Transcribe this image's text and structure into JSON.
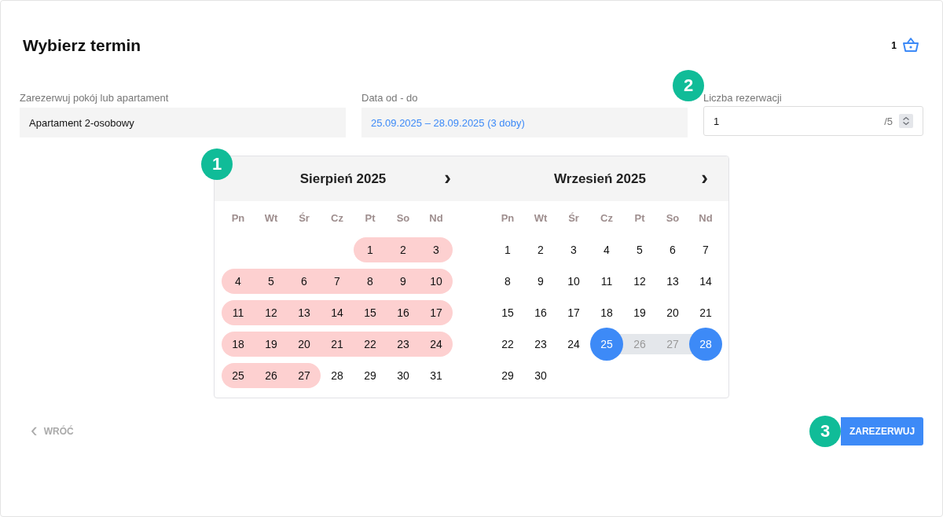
{
  "title": "Wybierz termin",
  "cart": {
    "count": "1"
  },
  "fields": [
    {
      "label": "Zarezerwuj pokój lub apartament",
      "value": "Apartament 2-osobowy",
      "kind": "select"
    },
    {
      "label": "Data od - do",
      "value": "25.09.2025 – 28.09.2025 (3 doby)",
      "kind": "date"
    },
    {
      "label": "Liczba rezerwacji",
      "value": "1",
      "max": "/5",
      "kind": "number",
      "step": "2"
    }
  ],
  "calendar": {
    "step": "1",
    "months": [
      {
        "title": "Sierpień 2025",
        "next": "›",
        "weekdays": [
          "Pn",
          "Wt",
          "Śr",
          "Cz",
          "Pt",
          "So",
          "Nd"
        ],
        "weeks": [
          {
            "kind": "right_aligned",
            "days": [
              {
                "day": "1",
                "kind": "blocked"
              },
              {
                "day": "2",
                "kind": "blocked"
              },
              {
                "day": "3",
                "kind": "blocked"
              }
            ]
          },
          {
            "days": [
              {
                "day": "4",
                "kind": "blocked"
              },
              {
                "day": "5",
                "kind": "blocked"
              },
              {
                "day": "6",
                "kind": "blocked"
              },
              {
                "day": "7",
                "kind": "blocked"
              },
              {
                "day": "8",
                "kind": "blocked"
              },
              {
                "day": "9",
                "kind": "blocked"
              },
              {
                "day": "10",
                "kind": "blocked"
              }
            ]
          },
          {
            "days": [
              {
                "day": "11",
                "kind": "blocked"
              },
              {
                "day": "12",
                "kind": "blocked"
              },
              {
                "day": "13",
                "kind": "blocked"
              },
              {
                "day": "14",
                "kind": "blocked"
              },
              {
                "day": "15",
                "kind": "blocked"
              },
              {
                "day": "16",
                "kind": "blocked"
              },
              {
                "day": "17",
                "kind": "blocked"
              }
            ]
          },
          {
            "days": [
              {
                "day": "18",
                "kind": "blocked"
              },
              {
                "day": "19",
                "kind": "blocked"
              },
              {
                "day": "20",
                "kind": "blocked"
              },
              {
                "day": "21",
                "kind": "blocked"
              },
              {
                "day": "22",
                "kind": "blocked"
              },
              {
                "day": "23",
                "kind": "blocked"
              },
              {
                "day": "24",
                "kind": "blocked"
              }
            ]
          },
          {
            "days": [
              {
                "day": "25",
                "kind": "blocked"
              },
              {
                "day": "26",
                "kind": "blocked"
              },
              {
                "day": "27",
                "kind": "blocked"
              },
              {
                "day": "28",
                "kind": "free"
              },
              {
                "day": "29",
                "kind": "free"
              },
              {
                "day": "30",
                "kind": "free"
              },
              {
                "day": "31",
                "kind": "free"
              }
            ]
          }
        ]
      },
      {
        "title": "Wrzesień 2025",
        "next": "›",
        "weekdays": [
          "Pn",
          "Wt",
          "Śr",
          "Cz",
          "Pt",
          "So",
          "Nd"
        ],
        "weeks": [
          {
            "days": [
              {
                "day": "1",
                "kind": "free"
              },
              {
                "day": "2",
                "kind": "free"
              },
              {
                "day": "3",
                "kind": "free"
              },
              {
                "day": "4",
                "kind": "free"
              },
              {
                "day": "5",
                "kind": "free"
              },
              {
                "day": "6",
                "kind": "free"
              },
              {
                "day": "7",
                "kind": "free"
              }
            ]
          },
          {
            "days": [
              {
                "day": "8",
                "kind": "free"
              },
              {
                "day": "9",
                "kind": "free"
              },
              {
                "day": "10",
                "kind": "free"
              },
              {
                "day": "11",
                "kind": "free"
              },
              {
                "day": "12",
                "kind": "free"
              },
              {
                "day": "13",
                "kind": "free"
              },
              {
                "day": "14",
                "kind": "free"
              }
            ]
          },
          {
            "days": [
              {
                "day": "15",
                "kind": "free"
              },
              {
                "day": "16",
                "kind": "free"
              },
              {
                "day": "17",
                "kind": "free"
              },
              {
                "day": "18",
                "kind": "free"
              },
              {
                "day": "19",
                "kind": "free"
              },
              {
                "day": "20",
                "kind": "free"
              },
              {
                "day": "21",
                "kind": "free"
              }
            ]
          },
          {
            "days": [
              {
                "day": "22",
                "kind": "free"
              },
              {
                "day": "23",
                "kind": "free"
              },
              {
                "day": "24",
                "kind": "free"
              },
              {
                "day": "25",
                "kind": "selected"
              },
              {
                "day": "26",
                "kind": "range"
              },
              {
                "day": "27",
                "kind": "range"
              },
              {
                "day": "28",
                "kind": "selected"
              }
            ]
          },
          {
            "days": [
              {
                "day": "29",
                "kind": "free"
              },
              {
                "day": "30",
                "kind": "free"
              }
            ]
          }
        ]
      }
    ]
  },
  "back": {
    "icon": "‹",
    "label": "WRÓĆ"
  },
  "submit": {
    "label": "ZAREZERWUJ",
    "step": "3"
  }
}
